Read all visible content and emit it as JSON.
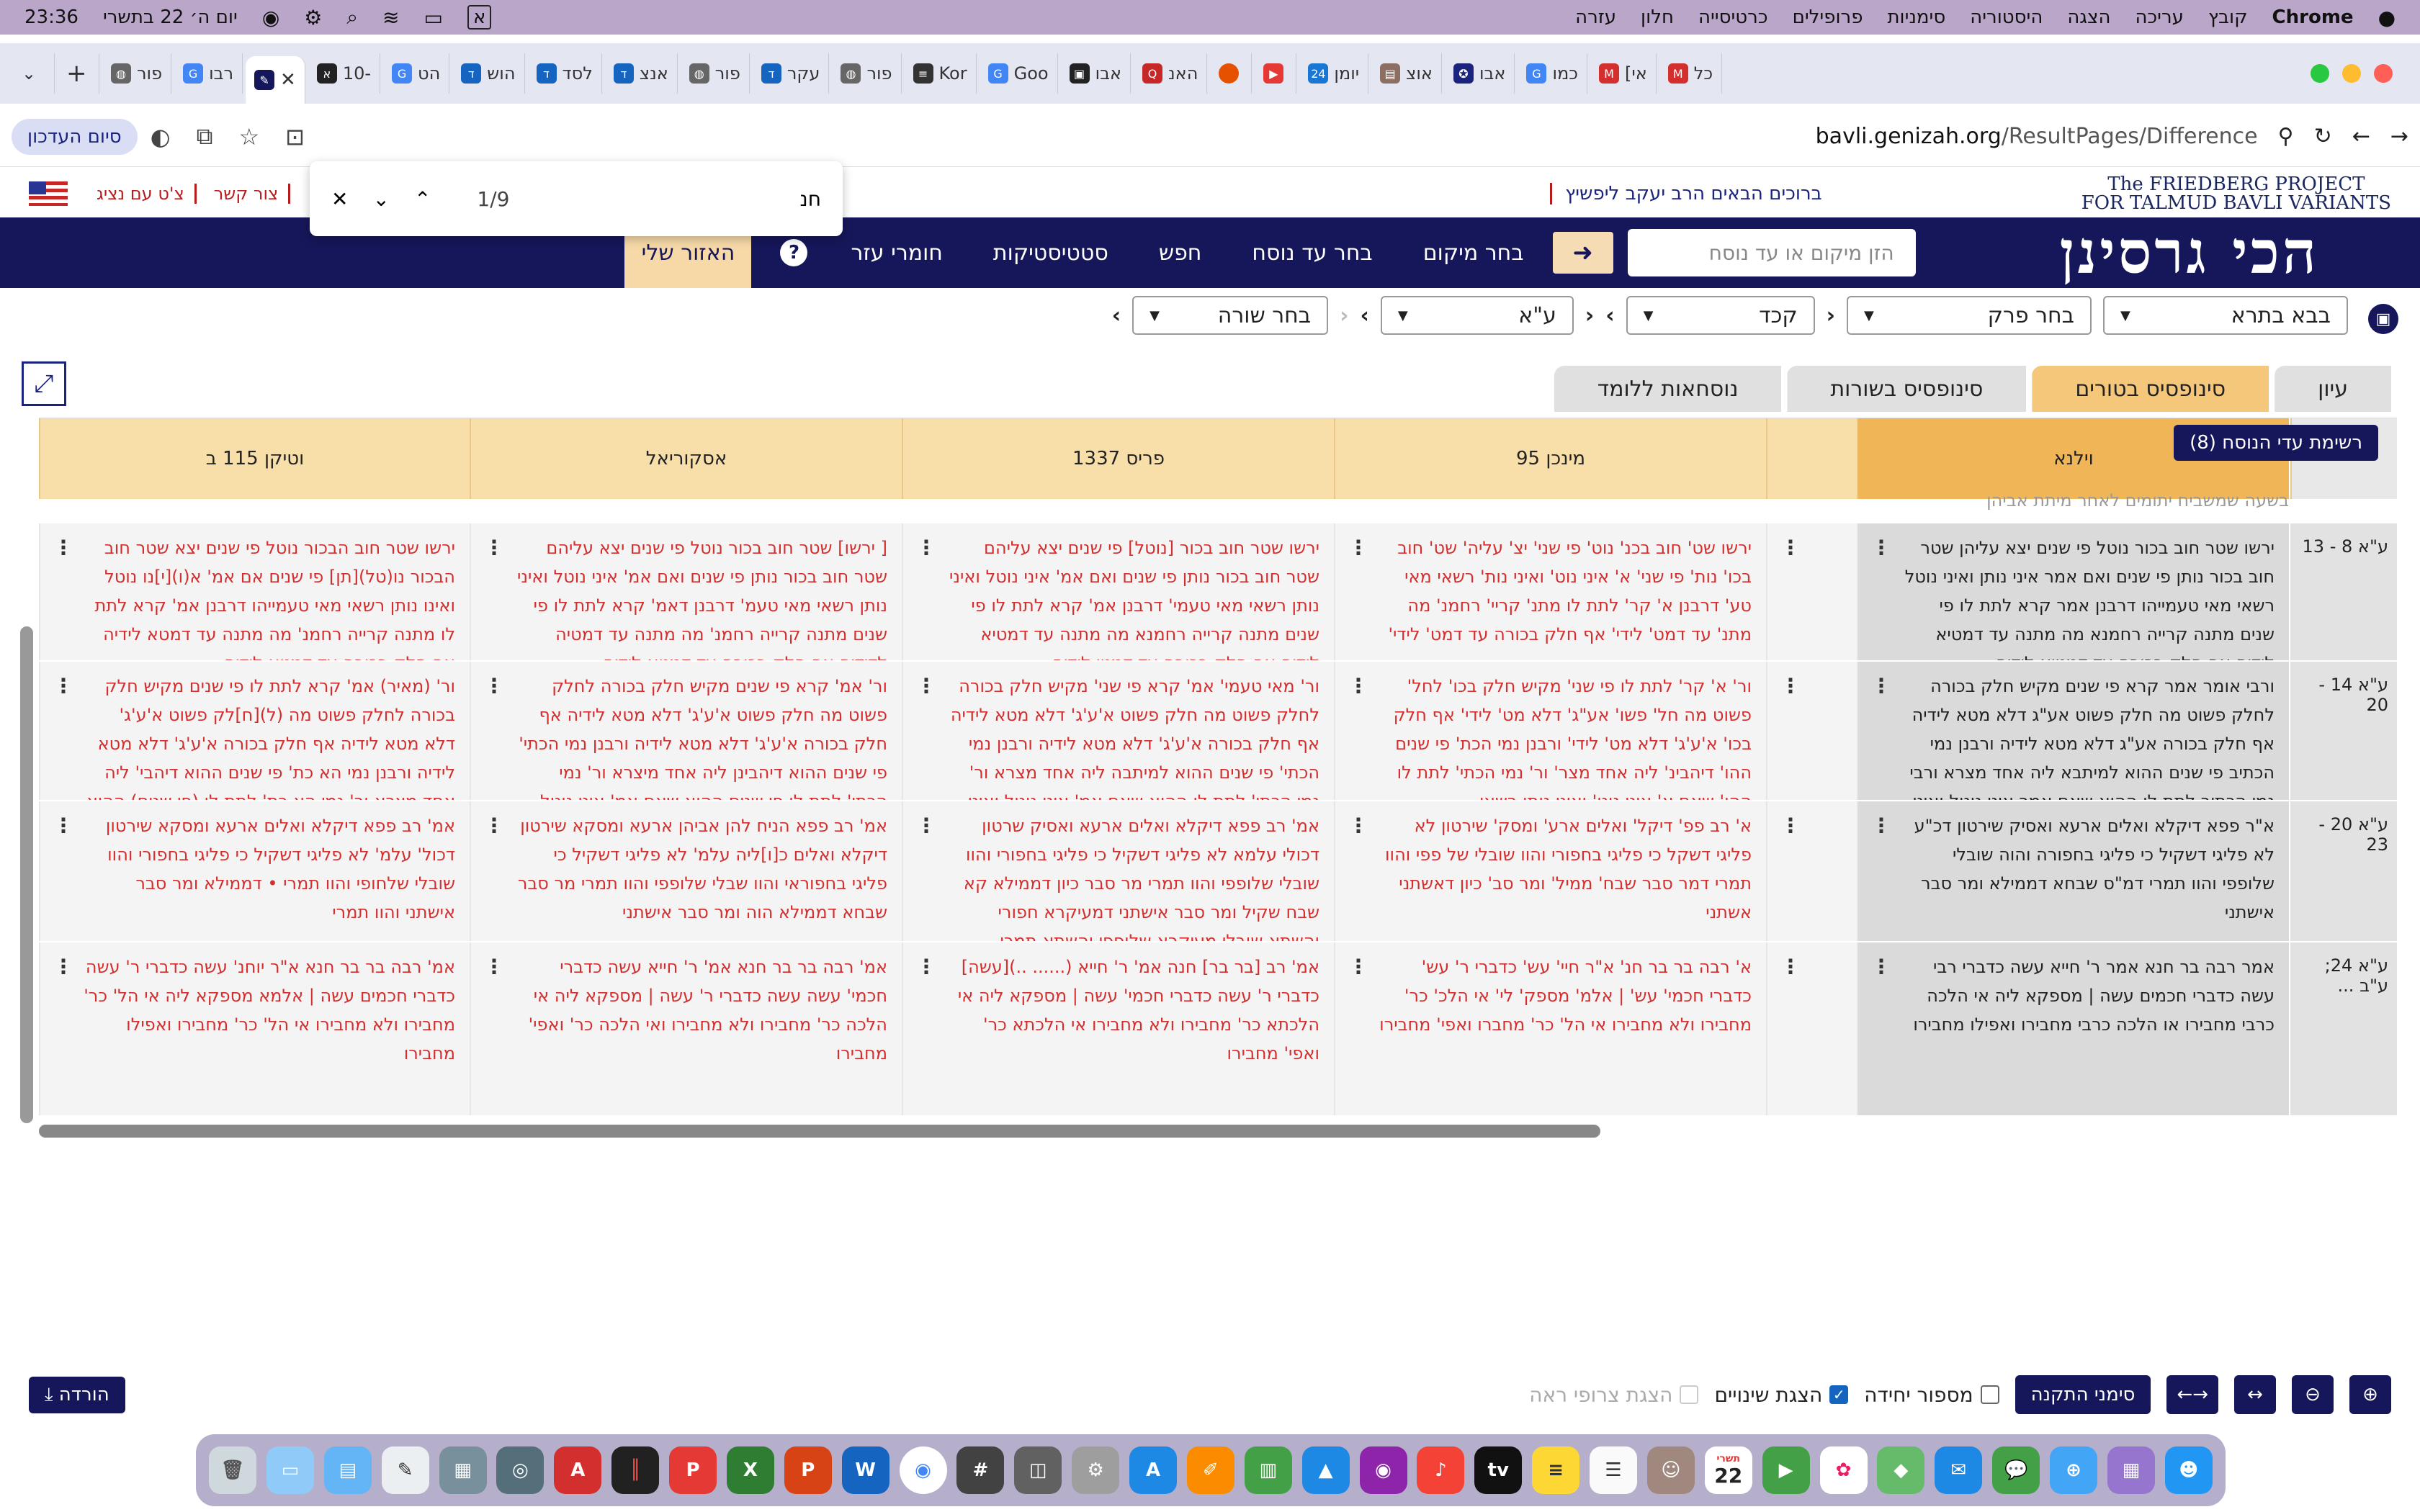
{
  "menubar": {
    "time": "23:36",
    "date": "יום ה׳ 22 בתשרי",
    "input_lang": "א",
    "items": [
      "עזרה",
      "חלון",
      "כרטיסייה",
      "פרופילים",
      "סימניות",
      "היסטוריה",
      "הצגה",
      "עריכה",
      "קובץ",
      "Chrome"
    ]
  },
  "tabs": [
    "כל",
    "כמו",
    "[אי",
    "אבו",
    "אוצ",
    "יומן",
    "האנ",
    "אבו",
    "Goo",
    "Kor",
    "פור",
    "עקר",
    "פור",
    "אנצ",
    "לסד",
    "הוש",
    "הט",
    "10-",
    "",
    "רבו",
    "פור"
  ],
  "address": {
    "host": "bavli.genizah.org",
    "path": "/ResultPages/Difference",
    "finish_label": "סיום העדכון"
  },
  "find": {
    "term": "חנ",
    "count": "1/9"
  },
  "site": {
    "project_line1": "The FRIEDBERG PROJECT",
    "project_line2": "FOR TALMUD BAVLI VARIANTS",
    "rabbi": "ברוכים הבאים הרב יעקב ליפשיץ",
    "quicklinks": [
      "צור קשר",
      "צ'ט עם נציג"
    ],
    "logo": "הכי גרסינן",
    "search_placeholder": "הזן מיקום או עד נוסח",
    "nav": [
      "בחר מיקום",
      "בחר עד נוסח",
      "חפש",
      "סטטיסטיקות",
      "חומרי עזר"
    ],
    "help": "?",
    "my_area": "האזור שלי"
  },
  "selectors": {
    "tractate": "בבא בתרא",
    "chapter": "בחר פרק",
    "page": "קכד",
    "side": "ע\"א",
    "line": "בחר שורה"
  },
  "view_tabs": [
    "עיון",
    "סינופסיס בטורים",
    "סינופסיס בשורות",
    "נוסחאות ללומד"
  ],
  "witness_btn": "רשימת עדי הנוסח (8)",
  "faded_text": "בשעה שמשביח יתומים לאחר מיתת אביהן",
  "columns": [
    "וילנא",
    "מינכן 95",
    "פריס 1337",
    "אסקוריאל",
    "וטיקן 115 ב"
  ],
  "row_labels": [
    "ע\"א 8 - 13",
    "ע\"א 14 - 20",
    "ע\"א 20 - 23",
    "ע\"א 24; ע\"ב ..."
  ],
  "rows": [
    [
      "ירשו שטר חוב בכור נוטל פי שנים יצא עליהן שטר חוב בכור נותן פי שנים ואם אמר איני נותן ואיני נוטל רשאי מאי טעמייהו דרבנן אמר קרא לתת לו פי שנים מתנה קרייה רחמנא מה מתנה עד דמטיא לידיה אף חלק בכורה עד דמטיא לידיה",
      "ירשו שט' חוב בכנ' נוט' פי שני' יצ' עליה' שט' חוב בכו' נות' פי שני' א' איני נוט' ואיני נות' רשאי מאי טע' דרבנן א' קר' לתת לו מתנ' קריי' רחמנ' מה מתנ' עד דמט' לידי' אף חלק בכורה עד דמט' לידי'",
      "ירשו שטר חוב בכור [נוטל] פי שנים יצא עליהם שטר חוב בכור נותן פי שנים ואם אמ' איני נוטל ואיני נותן רשאי מאי טעמי' דרבנן אמ' קרא לתת לו פי שנים מתנה קרייה רחמנא מה מתנה עד דמטיא לידיה אף חלק בכורה עד דמטי לידיה",
      "[ ירשו] שטר חוב בכור נוטל פי שנים יצא עליהם שטר חוב בכור נותן פי שנים ואם אמ' איני נוטל ואיני נותן רשאי מאי טעמ' דרבנן דאמ' קרא לתת לו פי שנים מתנה קרייה רחמנ' מה מתנה עד דמטיה לדידיה אף חלק בכורה עד דמטא לידיה",
      "ירשו שטר חוב הבכור נוטל פי שנים יצא שטר חוב הבכור נו(טל)[תן] פי שנים אם אמ' א(ו)[י]נו נוטל ואינו נותן רשאי מאי טעמייהו דרבנן אמ' קרא לתת לו מתנה קרייה רחמנ' מה מתנה עד דמטא לידיה אף חלק בכורה עד דמטא לידיה"
    ],
    [
      "ורבי אומר אמר קרא פי שנים מקיש חלק בכורה לחלק פשוט מה חלק פשוט אע\"ג דלא מטא לידיה אף חלק בכורה אע\"ג דלא מטא לידיה ורבנן נמי הכתיב פי שנים ההוא למיתבא ליה אחד מצרא ורבי נמי הכתיב לתת לו ההוא שאם אמר איני נוטל ואיני נותן רשאי",
      "ור' א' קר' לתת לו פי שני' מקיש חלק בכו' לחל' פשוט מה חל' פשו' אע\"ג' דלא מט' לידי' אף חלק בכו' א'ע'ג' דלא מט' לידי' ורבנן נמי הכת' פי שנים ההו' דיהבינ' ליה אחד מצר' ור' נמי הכתי' לתת לו ההו' שאם א' איני נוט' ואיני נותן רשאי",
      "ור' מאי טעמי' אמ' קרא פי שני' מקיש חלק בכורה לחלק פשוט מה חלק פשוט א'ע'ג' דלא מטא לידיה אף חלק בכורה א'ע'ג' דלא מטא לידיה ורבנן נמי הכתי' פי שנים ההוא למיתבה ליה אחד מצרא ור' נמי הכתי' לתת לו ההוא שאם אמ' איני נוטל ואיני נותן רשאי",
      "ור' אמ' קרא פי שנים מקיש חלק בכורה לחלק פשוט מה חלק פשוט א'ע'ג' דלא מטא לידיה אף חלק בכורה א'ע'ג' דלא מטא לידיה ורבנן נמי הכתי' פי שנים ההוא דיהבינן ליה אחד מיצרא ור' נמי הכתי' לתת לו פי שנים ההוא שאם אמ' איני נוטל ואיני נותן רשאי",
      "ור' (מאיר) אמ' קרא לתת לו פי שנים מקיש חלק בכורה לחלק פשוט מה (ל)[ח]לק פשוט א'ע'ג' דלא מטא לידיה אף חלק בכורה א'ע'ג' דלא מטא לידיה ורבנן נמי הא כת' פי שנים ההוא דיהבי' ליה אחד מצרא ור' נמי הא כת' לתת לו (פי שנים) ההוא שאם אמ' איני נוטל ואיני נותן רשאי"
    ],
    [
      "א\"ר פפא דיקלא ואלים ארעא ואסיק שירטון דכ\"ע לא פליגי דשקיל כי פליגי בחפורה והוה שובלי שלופפי והוו תמרי דמ\"ס שבחא דממילא ומר סבר אישתני",
      "א' רב פפ' דיקל' ואלים ארע' ומסק' שירטון לא פליגי דשקל כי פליגי בחפורי והוו שובלי של פפי והוו תמרי דמר סבר שבח' ממיל' ומר סב' כיון דאשתני אשתני",
      "אמ' רב פפא דיקלא ואלים ארעא ואסיק שרטון דכולי עלמא לא פליגי דשקיל כי פליגי בחפורי והוו שובלי שלופפי והוו תמרי מר סבר כיון דממילא קא שבח שקיל ומר סבר אישתני דמעיקרא חפורי והשתא שובלי מעיקרא שלופפי והשתא תמרי",
      "אמ' רב פפא הניח להן אביהן ארעא ומסקא שירטון דיקלא ואלים כ[ו]ליה עלמ' לא פליגי דשקיל כי פליגי בחפוראי והוו שבלי שלופפי והוו תמרי מר סבר שבחא דממילא הוה ומר סבר אישתני",
      "אמ' רב פפא דיקלא ואלים ארעא ומסקא שירטון דכול' עלמ' לא פליגי דשקיל כי פליגי בחפורי והוו שובלי שלחופי והוו תמרי • דממילא ומר סבר אישתני והוו תמרי"
    ],
    [
      "אמר רבה בר חנא אמר ר' חייא עשה כדברי רבי עשה כדברי חכמים עשה | מספקא ליה אי הלכה כרבי מחבירו או הלכה כרבי מחבירו ואפילו מחבירו",
      "א' רבה בר בר חנ' א\"ר חיי' עש' כדברי ר' עש' כדברי חכמי' עש' | אלמ' מספק' לי' אי הלכ' כר' מחבירו ולא מחבירו אי הל' כר' מחברו ואפי' מחבירו",
      "אמ' רב [בר בר] חנה אמ' ר' חייא (...... ..)[עשה] כדברי ר' עשה כדברי חכמי' עשה | מספקא ליה אי הלכתא כר' מחבירו ולא מחבירו אי הלכתא כר' ואפי' מחבירו",
      "אמ' רבה בר בר חנא אמ' ר' חייא עשה כדברי חכמי' עשה עשה כדברי ר' עשה | מספקא ליה אי הלכה כר' מחבירו ולא מחבירו ואי הלכה כר' ואפי' מחבירו",
      "אמ' רבה בר בר חנא א\"ר יוחנ' עשה כדברי ר' עשה כדברי חכמים עשה | אלמא מספקא ליה אי הל' כר' מחבירו ולא מחבירו אי הל' כר' מחבירו ואפילו מחבירו"
    ]
  ],
  "bottom": {
    "zoom_in": "+",
    "zoom_out": "-",
    "corrections": "סימני התקנה",
    "unit_number": "מספור יחידה",
    "show_changes": "הצגת שינויים",
    "show_attachments": "הצגת צרופי ראה",
    "download": "הורדה"
  },
  "dock": {
    "calendar_day": "22",
    "calendar_month": "תשרי"
  },
  "colors": {
    "navy": "#16165a",
    "header_tan": "#f8dfa9",
    "active_col": "#f0b557",
    "variant_red": "#d32f2f",
    "highlight": "#ffeb3b"
  }
}
